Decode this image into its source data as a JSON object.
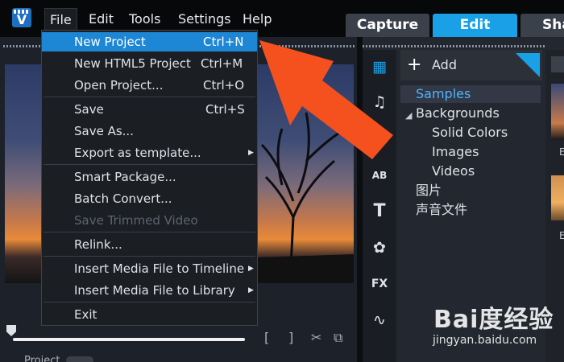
{
  "menubar": {
    "items": [
      "File",
      "Edit",
      "Tools",
      "Settings",
      "Help"
    ]
  },
  "tabs": [
    "Capture",
    "Edit",
    "Sha"
  ],
  "file_menu": {
    "items": [
      {
        "label": "New Project",
        "shortcut": "Ctrl+N"
      },
      {
        "label": "New HTML5 Project",
        "shortcut": "Ctrl+M"
      },
      {
        "label": "Open Project...",
        "shortcut": "Ctrl+O"
      },
      {
        "label": "Save",
        "shortcut": "Ctrl+S"
      },
      {
        "label": "Save As..."
      },
      {
        "label": "Export as template..."
      },
      {
        "label": "Smart Package..."
      },
      {
        "label": "Batch Convert..."
      },
      {
        "label": "Save Trimmed Video"
      },
      {
        "label": "Relink..."
      },
      {
        "label": "Insert Media File to Timeline"
      },
      {
        "label": "Insert Media File to Library"
      },
      {
        "label": "Exit"
      }
    ]
  },
  "preview": {
    "project_label": "Project"
  },
  "library": {
    "add_label": "Add",
    "tree": [
      "Samples",
      "Backgrounds",
      "Solid Colors",
      "Images",
      "Videos",
      "图片",
      "声音文件"
    ],
    "thumb_labels": [
      "E",
      "E"
    ]
  },
  "watermark": {
    "logo": "Bai度经验",
    "url": "jingyan.baidu.com"
  },
  "colors": {
    "accent": "#1aa0e6",
    "menu_highlight": "#1d87d6",
    "arrow": "#f4511e"
  },
  "icons": {
    "app": "app-logo-icon",
    "add": "plus-icon",
    "pin": "pin-icon",
    "media": "media-library-icon",
    "audio": "audio-icon",
    "instant": "magic-wand-icon",
    "transition": "transition-icon",
    "title": "title-icon",
    "graphic": "graphic-icon",
    "fx": "fx-icon",
    "path": "motion-path-icon"
  }
}
